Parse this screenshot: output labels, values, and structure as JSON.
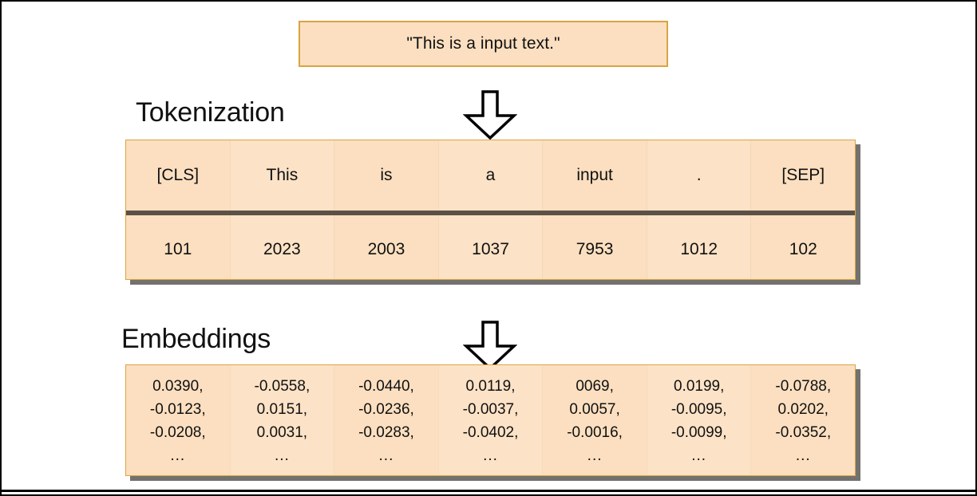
{
  "diagram": {
    "input": {
      "text": "\"This is a input text.\""
    },
    "arrows": {
      "first": "down-arrow-to-tokenization",
      "second": "down-arrow-to-embeddings"
    },
    "sections": [
      {
        "heading": "Tokenization"
      },
      {
        "heading": "Embeddings"
      }
    ],
    "tokenization": {
      "heading": "Tokenization",
      "tokens": [
        "[CLS]",
        "This",
        "is",
        "a",
        "input",
        ".",
        "[SEP]"
      ],
      "token_ids": [
        "101",
        "2023",
        "2003",
        "1037",
        "7953",
        "1012",
        "102"
      ]
    },
    "embeddings": {
      "heading": "Embeddings",
      "ellipsis": "...",
      "columns": [
        {
          "values": [
            "0.0390,",
            "-0.0123,",
            "-0.0208,"
          ]
        },
        {
          "values": [
            "-0.0558,",
            "0.0151,",
            "0.0031,"
          ]
        },
        {
          "values": [
            "-0.0440,",
            "-0.0236,",
            "-0.0283,"
          ]
        },
        {
          "values": [
            "0.0119,",
            "-0.0037,",
            "-0.0402,"
          ]
        },
        {
          "values": [
            "0069,",
            "0.0057,",
            "-0.0016,"
          ]
        },
        {
          "values": [
            "0.0199,",
            "-0.0095,",
            "-0.0099,"
          ]
        },
        {
          "values": [
            "-0.0788,",
            "0.0202,",
            "-0.0352,"
          ]
        }
      ]
    },
    "colors": {
      "panel_fill": "#fbdfc0",
      "panel_border": "#d9a441",
      "panel_shadow": "#5a5855",
      "row_divider": "#5b5147",
      "text": "#111111",
      "page_background": "#ffffff",
      "rule": "#000000"
    }
  }
}
